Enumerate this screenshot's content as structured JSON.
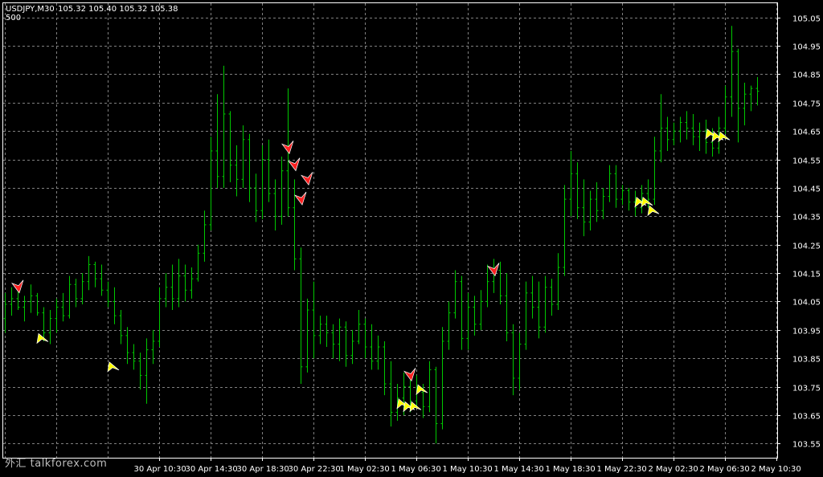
{
  "header": {
    "symbol": "USDJPY,M30",
    "quote": "105.32 105.40 105.32 105.38",
    "sub_label": "500"
  },
  "watermark": "外汇 talkforex.com",
  "chart_data": {
    "type": "bar",
    "title": "USDJPY,M30",
    "style": "OHLC bar chart, green bars on black with dotted grey grid",
    "colors": {
      "background": "#000000",
      "bars": "#00c800",
      "grid": "#808080",
      "axis": "#ffffff",
      "sell_arrow": "#ff2020",
      "buy_arrow": "#ffff00"
    },
    "ylim": [
      103.5,
      105.1
    ],
    "y_ticks": [
      105.05,
      104.95,
      104.85,
      104.75,
      104.65,
      104.55,
      104.45,
      104.35,
      104.25,
      104.15,
      104.05,
      103.95,
      103.85,
      103.75,
      103.65,
      103.55
    ],
    "x_tick_labels": [
      "30 Apr 10:30",
      "30 Apr 14:30",
      "30 Apr 18:30",
      "30 Apr 22:30",
      "1 May 02:30",
      "1 May 06:30",
      "1 May 10:30",
      "1 May 14:30",
      "1 May 18:30",
      "1 May 22:30",
      "2 May 02:30",
      "2 May 06:30",
      "2 May 10:30"
    ],
    "x_tick_bar_index": [
      24,
      32,
      40,
      48,
      56,
      64,
      72,
      80,
      88,
      96,
      104,
      112,
      120
    ],
    "bars": [
      {
        "o": 103.99,
        "h": 104.08,
        "l": 103.94,
        "c": 104.04
      },
      {
        "o": 104.04,
        "h": 104.1,
        "l": 104.0,
        "c": 104.06
      },
      {
        "o": 104.06,
        "h": 104.09,
        "l": 104.02,
        "c": 104.03
      },
      {
        "o": 104.03,
        "h": 104.07,
        "l": 103.98,
        "c": 104.05
      },
      {
        "o": 104.05,
        "h": 104.11,
        "l": 104.01,
        "c": 104.07
      },
      {
        "o": 104.07,
        "h": 104.08,
        "l": 104.0,
        "c": 104.01
      },
      {
        "o": 104.01,
        "h": 104.03,
        "l": 103.91,
        "c": 103.94
      },
      {
        "o": 103.94,
        "h": 104.02,
        "l": 103.9,
        "c": 103.99
      },
      {
        "o": 103.99,
        "h": 104.06,
        "l": 103.94,
        "c": 104.03
      },
      {
        "o": 104.03,
        "h": 104.08,
        "l": 103.98,
        "c": 104.0
      },
      {
        "o": 104.0,
        "h": 104.14,
        "l": 103.99,
        "c": 104.11
      },
      {
        "o": 104.11,
        "h": 104.13,
        "l": 104.03,
        "c": 104.06
      },
      {
        "o": 104.06,
        "h": 104.15,
        "l": 104.04,
        "c": 104.12
      },
      {
        "o": 104.12,
        "h": 104.21,
        "l": 104.09,
        "c": 104.18
      },
      {
        "o": 104.18,
        "h": 104.19,
        "l": 104.1,
        "c": 104.13
      },
      {
        "o": 104.13,
        "h": 104.18,
        "l": 104.07,
        "c": 104.09
      },
      {
        "o": 104.09,
        "h": 104.12,
        "l": 104.03,
        "c": 104.05
      },
      {
        "o": 104.05,
        "h": 104.1,
        "l": 103.97,
        "c": 104.0
      },
      {
        "o": 104.0,
        "h": 104.02,
        "l": 103.9,
        "c": 103.93
      },
      {
        "o": 103.93,
        "h": 103.96,
        "l": 103.83,
        "c": 103.87
      },
      {
        "o": 103.87,
        "h": 103.9,
        "l": 103.81,
        "c": 103.84
      },
      {
        "o": 103.84,
        "h": 103.87,
        "l": 103.74,
        "c": 103.79
      },
      {
        "o": 103.79,
        "h": 103.92,
        "l": 103.69,
        "c": 103.88
      },
      {
        "o": 103.88,
        "h": 103.95,
        "l": 103.83,
        "c": 103.91
      },
      {
        "o": 103.91,
        "h": 104.1,
        "l": 103.89,
        "c": 104.06
      },
      {
        "o": 104.06,
        "h": 104.15,
        "l": 104.03,
        "c": 104.1
      },
      {
        "o": 104.1,
        "h": 104.18,
        "l": 104.02,
        "c": 104.06
      },
      {
        "o": 104.06,
        "h": 104.2,
        "l": 104.03,
        "c": 104.14
      },
      {
        "o": 104.14,
        "h": 104.18,
        "l": 104.05,
        "c": 104.09
      },
      {
        "o": 104.09,
        "h": 104.17,
        "l": 104.06,
        "c": 104.13
      },
      {
        "o": 104.13,
        "h": 104.25,
        "l": 104.12,
        "c": 104.22
      },
      {
        "o": 104.22,
        "h": 104.37,
        "l": 104.19,
        "c": 104.32
      },
      {
        "o": 104.32,
        "h": 104.63,
        "l": 104.3,
        "c": 104.58
      },
      {
        "o": 104.58,
        "h": 104.78,
        "l": 104.45,
        "c": 104.49
      },
      {
        "o": 104.49,
        "h": 104.88,
        "l": 104.45,
        "c": 104.71
      },
      {
        "o": 104.71,
        "h": 104.72,
        "l": 104.47,
        "c": 104.53
      },
      {
        "o": 104.53,
        "h": 104.6,
        "l": 104.42,
        "c": 104.48
      },
      {
        "o": 104.48,
        "h": 104.67,
        "l": 104.45,
        "c": 104.62
      },
      {
        "o": 104.62,
        "h": 104.64,
        "l": 104.4,
        "c": 104.45
      },
      {
        "o": 104.45,
        "h": 104.5,
        "l": 104.33,
        "c": 104.37
      },
      {
        "o": 104.37,
        "h": 104.6,
        "l": 104.34,
        "c": 104.55
      },
      {
        "o": 104.55,
        "h": 104.62,
        "l": 104.4,
        "c": 104.43
      },
      {
        "o": 104.43,
        "h": 104.48,
        "l": 104.3,
        "c": 104.35
      },
      {
        "o": 104.35,
        "h": 104.56,
        "l": 104.32,
        "c": 104.51
      },
      {
        "o": 104.51,
        "h": 104.8,
        "l": 104.35,
        "c": 104.38
      },
      {
        "o": 104.38,
        "h": 104.48,
        "l": 104.16,
        "c": 104.2
      },
      {
        "o": 104.2,
        "h": 104.24,
        "l": 103.76,
        "c": 103.82
      },
      {
        "o": 103.82,
        "h": 104.06,
        "l": 103.8,
        "c": 104.02
      },
      {
        "o": 104.02,
        "h": 104.12,
        "l": 103.85,
        "c": 103.93
      },
      {
        "o": 103.93,
        "h": 104.0,
        "l": 103.9,
        "c": 103.97
      },
      {
        "o": 103.97,
        "h": 104.0,
        "l": 103.89,
        "c": 103.94
      },
      {
        "o": 103.94,
        "h": 103.97,
        "l": 103.85,
        "c": 103.9
      },
      {
        "o": 103.9,
        "h": 103.99,
        "l": 103.84,
        "c": 103.96
      },
      {
        "o": 103.96,
        "h": 103.98,
        "l": 103.82,
        "c": 103.86
      },
      {
        "o": 103.86,
        "h": 103.95,
        "l": 103.83,
        "c": 103.91
      },
      {
        "o": 103.91,
        "h": 104.02,
        "l": 103.9,
        "c": 103.97
      },
      {
        "o": 103.97,
        "h": 103.99,
        "l": 103.85,
        "c": 103.89
      },
      {
        "o": 103.89,
        "h": 103.97,
        "l": 103.81,
        "c": 103.84
      },
      {
        "o": 103.84,
        "h": 103.93,
        "l": 103.81,
        "c": 103.89
      },
      {
        "o": 103.89,
        "h": 103.91,
        "l": 103.72,
        "c": 103.76
      },
      {
        "o": 103.76,
        "h": 103.84,
        "l": 103.61,
        "c": 103.66
      },
      {
        "o": 103.66,
        "h": 103.76,
        "l": 103.63,
        "c": 103.71
      },
      {
        "o": 103.71,
        "h": 103.8,
        "l": 103.65,
        "c": 103.75
      },
      {
        "o": 103.75,
        "h": 103.78,
        "l": 103.66,
        "c": 103.7
      },
      {
        "o": 103.7,
        "h": 103.79,
        "l": 103.68,
        "c": 103.73
      },
      {
        "o": 103.73,
        "h": 103.76,
        "l": 103.64,
        "c": 103.68
      },
      {
        "o": 103.68,
        "h": 103.84,
        "l": 103.66,
        "c": 103.81
      },
      {
        "o": 103.81,
        "h": 103.82,
        "l": 103.55,
        "c": 103.62
      },
      {
        "o": 103.62,
        "h": 103.96,
        "l": 103.6,
        "c": 103.91
      },
      {
        "o": 103.91,
        "h": 104.05,
        "l": 103.88,
        "c": 104.01
      },
      {
        "o": 104.01,
        "h": 104.16,
        "l": 103.99,
        "c": 104.12
      },
      {
        "o": 104.12,
        "h": 104.14,
        "l": 103.88,
        "c": 103.92
      },
      {
        "o": 103.92,
        "h": 104.08,
        "l": 103.88,
        "c": 104.03
      },
      {
        "o": 104.03,
        "h": 104.07,
        "l": 103.93,
        "c": 103.97
      },
      {
        "o": 103.97,
        "h": 104.09,
        "l": 103.95,
        "c": 104.05
      },
      {
        "o": 104.05,
        "h": 104.18,
        "l": 104.03,
        "c": 104.12
      },
      {
        "o": 104.12,
        "h": 104.2,
        "l": 104.08,
        "c": 104.16
      },
      {
        "o": 104.16,
        "h": 104.19,
        "l": 104.04,
        "c": 104.07
      },
      {
        "o": 104.07,
        "h": 104.15,
        "l": 103.91,
        "c": 103.94
      },
      {
        "o": 103.94,
        "h": 103.97,
        "l": 103.72,
        "c": 103.78
      },
      {
        "o": 103.78,
        "h": 103.94,
        "l": 103.74,
        "c": 103.9
      },
      {
        "o": 103.9,
        "h": 104.12,
        "l": 103.88,
        "c": 104.08
      },
      {
        "o": 104.08,
        "h": 104.14,
        "l": 103.99,
        "c": 104.03
      },
      {
        "o": 104.03,
        "h": 104.12,
        "l": 103.92,
        "c": 103.96
      },
      {
        "o": 103.96,
        "h": 104.14,
        "l": 103.94,
        "c": 104.1
      },
      {
        "o": 104.1,
        "h": 104.13,
        "l": 104.0,
        "c": 104.04
      },
      {
        "o": 104.04,
        "h": 104.22,
        "l": 104.02,
        "c": 104.17
      },
      {
        "o": 104.17,
        "h": 104.46,
        "l": 104.14,
        "c": 104.41
      },
      {
        "o": 104.41,
        "h": 104.58,
        "l": 104.35,
        "c": 104.5
      },
      {
        "o": 104.5,
        "h": 104.54,
        "l": 104.34,
        "c": 104.38
      },
      {
        "o": 104.38,
        "h": 104.48,
        "l": 104.28,
        "c": 104.33
      },
      {
        "o": 104.33,
        "h": 104.44,
        "l": 104.3,
        "c": 104.41
      },
      {
        "o": 104.41,
        "h": 104.47,
        "l": 104.33,
        "c": 104.37
      },
      {
        "o": 104.37,
        "h": 104.45,
        "l": 104.34,
        "c": 104.42
      },
      {
        "o": 104.42,
        "h": 104.53,
        "l": 104.4,
        "c": 104.5
      },
      {
        "o": 104.5,
        "h": 104.53,
        "l": 104.38,
        "c": 104.41
      },
      {
        "o": 104.41,
        "h": 104.46,
        "l": 104.39,
        "c": 104.44
      },
      {
        "o": 104.44,
        "h": 104.45,
        "l": 104.37,
        "c": 104.4
      },
      {
        "o": 104.4,
        "h": 104.44,
        "l": 104.35,
        "c": 104.38
      },
      {
        "o": 104.38,
        "h": 104.46,
        "l": 104.36,
        "c": 104.43
      },
      {
        "o": 104.43,
        "h": 104.48,
        "l": 104.38,
        "c": 104.41
      },
      {
        "o": 104.41,
        "h": 104.63,
        "l": 104.39,
        "c": 104.58
      },
      {
        "o": 104.58,
        "h": 104.78,
        "l": 104.54,
        "c": 104.66
      },
      {
        "o": 104.66,
        "h": 104.7,
        "l": 104.58,
        "c": 104.62
      },
      {
        "o": 104.62,
        "h": 104.68,
        "l": 104.6,
        "c": 104.65
      },
      {
        "o": 104.65,
        "h": 104.7,
        "l": 104.61,
        "c": 104.68
      },
      {
        "o": 104.68,
        "h": 104.72,
        "l": 104.62,
        "c": 104.66
      },
      {
        "o": 104.66,
        "h": 104.71,
        "l": 104.6,
        "c": 104.63
      },
      {
        "o": 104.63,
        "h": 104.68,
        "l": 104.58,
        "c": 104.65
      },
      {
        "o": 104.65,
        "h": 104.69,
        "l": 104.57,
        "c": 104.61
      },
      {
        "o": 104.61,
        "h": 104.66,
        "l": 104.56,
        "c": 104.59
      },
      {
        "o": 104.59,
        "h": 104.7,
        "l": 104.57,
        "c": 104.66
      },
      {
        "o": 104.66,
        "h": 104.81,
        "l": 104.64,
        "c": 104.77
      },
      {
        "o": 104.77,
        "h": 105.02,
        "l": 104.7,
        "c": 104.93
      },
      {
        "o": 104.93,
        "h": 104.94,
        "l": 104.61,
        "c": 104.73
      },
      {
        "o": 104.73,
        "h": 104.82,
        "l": 104.67,
        "c": 104.78
      },
      {
        "o": 104.78,
        "h": 104.81,
        "l": 104.72,
        "c": 104.8
      },
      {
        "o": 104.8,
        "h": 104.84,
        "l": 104.74,
        "c": 104.79
      }
    ],
    "arrows": [
      {
        "dir": "sell",
        "bar": 2,
        "price": 104.1
      },
      {
        "dir": "buy",
        "bar": 6,
        "price": 103.92
      },
      {
        "dir": "buy",
        "bar": 17,
        "price": 103.82
      },
      {
        "dir": "sell",
        "bar": 44,
        "price": 104.59
      },
      {
        "dir": "sell",
        "bar": 45,
        "price": 104.53
      },
      {
        "dir": "sell",
        "bar": 47,
        "price": 104.48
      },
      {
        "dir": "sell",
        "bar": 46,
        "price": 104.41
      },
      {
        "dir": "sell",
        "bar": 63,
        "price": 103.79
      },
      {
        "dir": "buy",
        "bar": 62,
        "price": 103.69
      },
      {
        "dir": "buy",
        "bar": 63,
        "price": 103.68
      },
      {
        "dir": "buy",
        "bar": 64,
        "price": 103.68
      },
      {
        "dir": "buy",
        "bar": 65,
        "price": 103.74
      },
      {
        "dir": "sell",
        "bar": 76,
        "price": 104.16
      },
      {
        "dir": "buy",
        "bar": 99,
        "price": 104.4
      },
      {
        "dir": "buy",
        "bar": 100,
        "price": 104.4
      },
      {
        "dir": "buy",
        "bar": 101,
        "price": 104.37
      },
      {
        "dir": "buy",
        "bar": 110,
        "price": 104.64
      },
      {
        "dir": "buy",
        "bar": 111,
        "price": 104.63
      },
      {
        "dir": "buy",
        "bar": 112,
        "price": 104.63
      }
    ]
  }
}
